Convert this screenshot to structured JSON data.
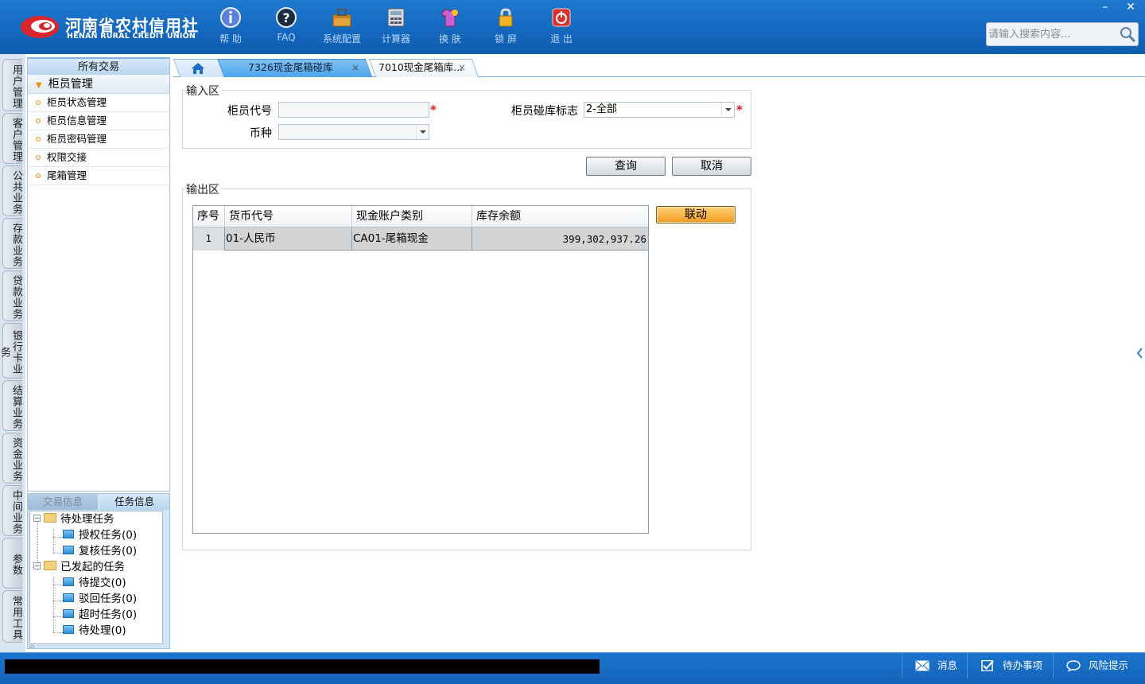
{
  "header": {
    "logo_cn": "河南省农村信用社",
    "logo_en": "HENAN RURAL CREDIT UNION",
    "tools": [
      {
        "label": "帮 助",
        "icon": "info-icon"
      },
      {
        "label": "FAQ",
        "icon": "question-icon"
      },
      {
        "label": "系统配置",
        "icon": "toolbox-icon"
      },
      {
        "label": "计算器",
        "icon": "calculator-icon"
      },
      {
        "label": "换 肤",
        "icon": "shirt-icon"
      },
      {
        "label": "锁 屏",
        "icon": "lock-icon"
      },
      {
        "label": "退 出",
        "icon": "power-icon"
      }
    ],
    "search_placeholder": "请输入搜索内容...",
    "window_min": "–",
    "window_close": "✕"
  },
  "vtabs": [
    "用户管理",
    "客户管理",
    "公共业务",
    "存款业务",
    "贷款业务",
    "银行卡业务",
    "结算业务",
    "资金业务",
    "中间业务",
    "参数",
    "常用工具"
  ],
  "nav": {
    "title": "所有交易",
    "group": "柜员管理",
    "items": [
      "柜员状态管理",
      "柜员信息管理",
      "柜员密码管理",
      "权限交接",
      "尾箱管理"
    ]
  },
  "tasks": {
    "tab_trade": "交易信息",
    "tab_task": "任务信息",
    "pending": "待处理任务",
    "auth": "授权任务(0)",
    "review": "复核任务(0)",
    "initiated": "已发起的任务",
    "to_submit": "待提交(0)",
    "rejected": "驳回任务(0)",
    "timeout": "超时任务(0)",
    "to_process": "待处理(0)"
  },
  "tabs": {
    "tab_a": "7326现金尾箱碰库",
    "tab_b": "7010现金尾箱库...",
    "close": "×"
  },
  "form": {
    "input_legend": "输入区",
    "teller_code_label": "柜员代号",
    "teller_code_value": "",
    "teller_flag_label": "柜员碰库标志",
    "teller_flag_value": "2-全部",
    "currency_label": "币种",
    "currency_value": "",
    "required_mark": "*",
    "query": "查询",
    "cancel": "取消",
    "output_legend": "输出区",
    "link": "联动"
  },
  "grid": {
    "columns": [
      "序号",
      "货币代号",
      "现金账户类别",
      "库存余额"
    ],
    "rows": [
      {
        "no": "1",
        "currency": "01-人民币",
        "type": "CA01-尾箱现金",
        "balance": "399,302,937.26"
      }
    ]
  },
  "status": {
    "message": "消息",
    "todo": "待办事项",
    "risk": "风险提示"
  }
}
